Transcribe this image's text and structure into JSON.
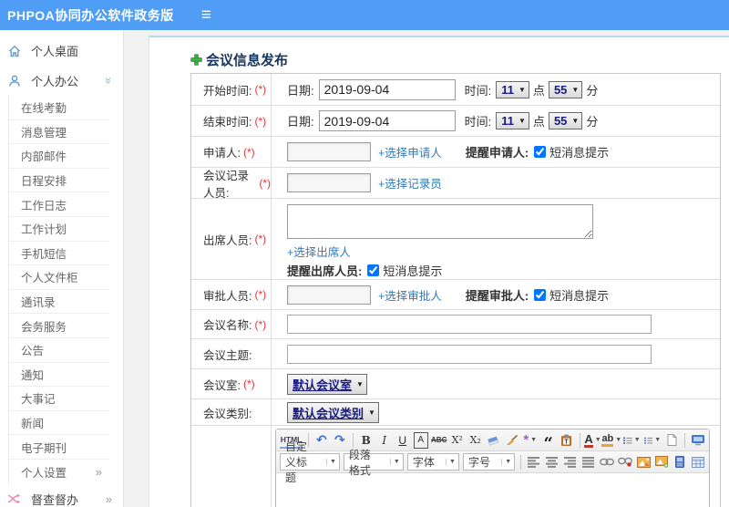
{
  "topbar": {
    "title": "PHPOA协同办公软件政务版"
  },
  "sidebar": {
    "items_top": [
      {
        "label": "个人桌面"
      },
      {
        "label": "个人办公"
      }
    ],
    "sub_items": [
      "在线考勤",
      "消息管理",
      "内部邮件",
      "日程安排",
      "工作日志",
      "工作计划",
      "手机短信",
      "个人文件柜",
      "通讯录",
      "会务服务",
      "公告",
      "通知",
      "大事记",
      "新闻",
      "电子期刊",
      "个人设置"
    ],
    "bottom_item": {
      "label": "督查督办"
    }
  },
  "page": {
    "title": "会议信息发布"
  },
  "form": {
    "start_time": {
      "label": "开始时间:",
      "required": "(*)",
      "date_label": "日期:",
      "date_value": "2019-09-04",
      "time_label": "时间:",
      "hour": "11",
      "hour_unit": "点",
      "minute": "55",
      "minute_unit": "分"
    },
    "end_time": {
      "label": "结束时间:",
      "required": "(*)",
      "date_label": "日期:",
      "date_value": "2019-09-04",
      "time_label": "时间:",
      "hour": "11",
      "hour_unit": "点",
      "minute": "55",
      "minute_unit": "分"
    },
    "applicant": {
      "label": "申请人:",
      "required": "(*)",
      "link": "+选择申请人",
      "remind": "提醒申请人:",
      "sms": "短消息提示"
    },
    "recorder": {
      "label": "会议记录人员:",
      "required": "(*)",
      "link": "+选择记录员"
    },
    "attendees": {
      "label": "出席人员:",
      "required": "(*)",
      "link": "+选择出席人",
      "remind": "提醒出席人员:",
      "sms": "短消息提示"
    },
    "approver": {
      "label": "审批人员:",
      "required": "(*)",
      "link": "+选择审批人",
      "remind": "提醒审批人:",
      "sms": "短消息提示"
    },
    "meeting_name": {
      "label": "会议名称:",
      "required": "(*)"
    },
    "meeting_subject": {
      "label": "会议主题:"
    },
    "meeting_room": {
      "label": "会议室:",
      "required": "(*)",
      "value": "默认会议室"
    },
    "meeting_category": {
      "label": "会议类别:",
      "value": "默认会议类别"
    }
  },
  "editor": {
    "html_tab": "HTML",
    "glyphs": {
      "undo": "↶",
      "redo": "↷",
      "bold": "B",
      "italic": "I",
      "underline": "U",
      "font_box": "A",
      "strike": "ABC",
      "superscript": "X²",
      "subscript": "X₂",
      "wand": "*",
      "quote": "“",
      "font_color": "A",
      "highlight": "ab"
    },
    "dropdowns": [
      "自定义标题",
      "段落格式",
      "字体",
      "字号"
    ]
  },
  "colors": {
    "topbar_bg": "#4f9df5",
    "link_blue": "#3579b8",
    "title_navy": "#17365d",
    "required_red": "#e53333",
    "select_navy": "#1a1a80",
    "sidebar_icon_blue": "#5b9bd5"
  }
}
